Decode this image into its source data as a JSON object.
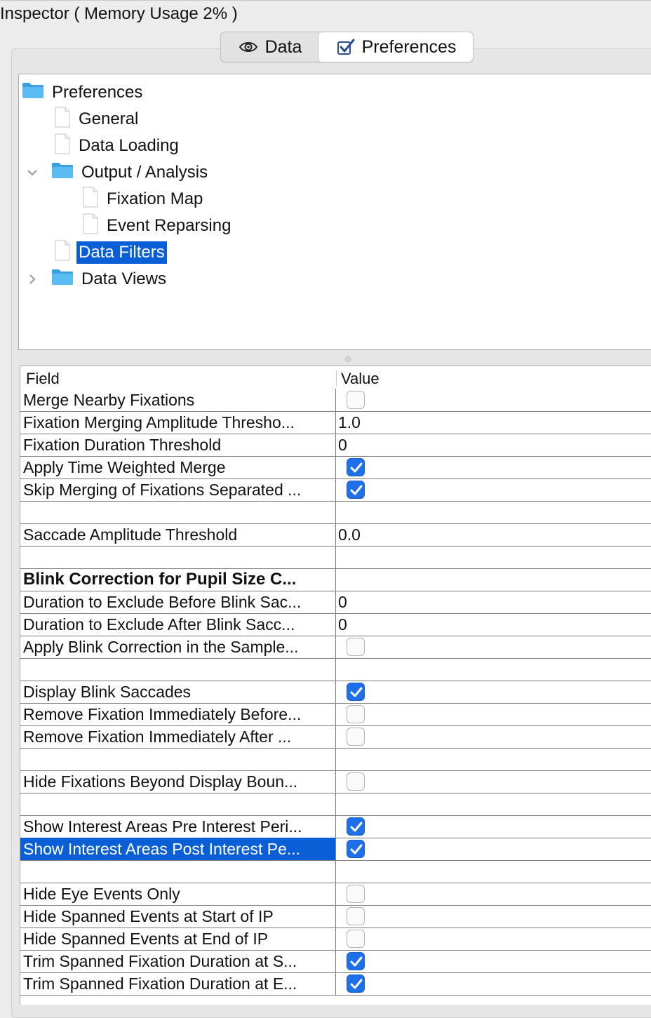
{
  "window": {
    "title": "Inspector ( Memory Usage 2% )"
  },
  "tabs": [
    {
      "label": "Data",
      "icon": "eye-icon",
      "active": false
    },
    {
      "label": "Preferences",
      "icon": "checkbox-check-icon",
      "active": true
    }
  ],
  "tree": {
    "nodes": [
      {
        "label": "Preferences",
        "type": "folder",
        "level": 0,
        "expanded": true
      },
      {
        "label": "General",
        "type": "file",
        "level": 1
      },
      {
        "label": "Data Loading",
        "type": "file",
        "level": 1
      },
      {
        "label": "Output / Analysis",
        "type": "folder",
        "level": 1,
        "expanded": true
      },
      {
        "label": "Fixation Map",
        "type": "file",
        "level": 2
      },
      {
        "label": "Event Reparsing",
        "type": "file",
        "level": 2
      },
      {
        "label": "Data Filters",
        "type": "file",
        "level": 1,
        "selected": true
      },
      {
        "label": "Data Views",
        "type": "folder",
        "level": 1,
        "expanded": false
      }
    ]
  },
  "table": {
    "columns": [
      "Field",
      "Value"
    ],
    "rows": [
      {
        "field": "Merge Nearby Fixations",
        "kind": "checkbox",
        "checked": false
      },
      {
        "field": "Fixation Merging Amplitude Thresho...",
        "kind": "text",
        "value": "1.0"
      },
      {
        "field": "Fixation Duration Threshold",
        "kind": "text",
        "value": "0"
      },
      {
        "field": "Apply Time Weighted Merge",
        "kind": "checkbox",
        "checked": true
      },
      {
        "field": "Skip Merging of Fixations Separated ...",
        "kind": "checkbox",
        "checked": true
      },
      {
        "field": "",
        "kind": "empty"
      },
      {
        "field": "Saccade Amplitude Threshold",
        "kind": "text",
        "value": "0.0"
      },
      {
        "field": "",
        "kind": "empty"
      },
      {
        "field": "Blink Correction for Pupil Size C...",
        "kind": "header"
      },
      {
        "field": "Duration to Exclude Before Blink Sac...",
        "kind": "text",
        "value": "0"
      },
      {
        "field": "Duration to Exclude After Blink Sacc...",
        "kind": "text",
        "value": "0"
      },
      {
        "field": "Apply Blink Correction in the Sample...",
        "kind": "checkbox",
        "checked": false
      },
      {
        "field": "",
        "kind": "empty"
      },
      {
        "field": "Display Blink Saccades",
        "kind": "checkbox",
        "checked": true
      },
      {
        "field": "Remove Fixation Immediately Before...",
        "kind": "checkbox",
        "checked": false
      },
      {
        "field": "Remove Fixation Immediately After ...",
        "kind": "checkbox",
        "checked": false
      },
      {
        "field": "",
        "kind": "empty"
      },
      {
        "field": "Hide Fixations Beyond Display Boun...",
        "kind": "checkbox",
        "checked": false
      },
      {
        "field": "",
        "kind": "empty"
      },
      {
        "field": "Show Interest Areas Pre Interest Peri...",
        "kind": "checkbox",
        "checked": true
      },
      {
        "field": "Show Interest Areas Post Interest Pe...",
        "kind": "checkbox",
        "checked": true,
        "selected": true
      },
      {
        "field": "",
        "kind": "empty"
      },
      {
        "field": "Hide Eye Events Only",
        "kind": "checkbox",
        "checked": false
      },
      {
        "field": "Hide Spanned Events at Start of IP",
        "kind": "checkbox",
        "checked": false
      },
      {
        "field": "Hide Spanned Events at End of IP",
        "kind": "checkbox",
        "checked": false
      },
      {
        "field": "Trim Spanned Fixation Duration at S...",
        "kind": "checkbox",
        "checked": true
      },
      {
        "field": "Trim Spanned Fixation Duration at E...",
        "kind": "checkbox",
        "checked": true
      }
    ]
  },
  "colors": {
    "selection": "#0b5fd6",
    "checkbox_on": "#1f6fe8",
    "folder": "#3aa0e0"
  }
}
